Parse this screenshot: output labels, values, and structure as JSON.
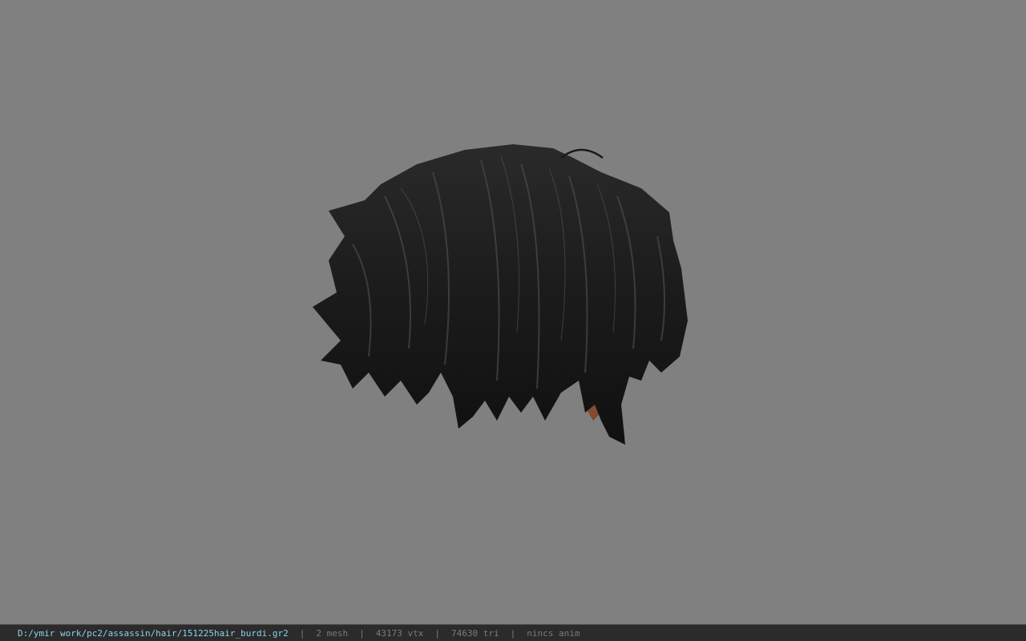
{
  "viewport": {
    "background_color": "#808080",
    "model": {
      "hair_color": "#1a1a1a",
      "skin_color": "#8a5233"
    }
  },
  "statusbar": {
    "file_path": "D:/ymir work/pc2/assassin/hair/151225hair_burdi.gr2",
    "separator": "|",
    "mesh_count": "2 mesh",
    "vertex_count": "43173 vtx",
    "triangle_count": "74630 tri",
    "anim_status": "nincs anim",
    "path_color": "#8fd0e8",
    "stat_color": "#7a7a7a"
  }
}
